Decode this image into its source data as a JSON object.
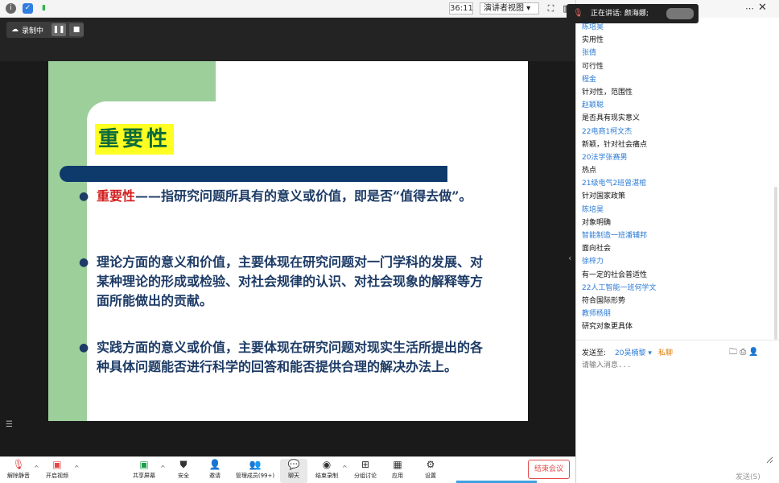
{
  "topbar": {
    "timer": "36:11",
    "view_mode": "演讲者视图 ▾"
  },
  "recording": {
    "label": "录制中"
  },
  "slide": {
    "title": "重要性",
    "bullets": [
      {
        "highlight": "重要性",
        "text": "——指研究问题所具有的意义或价值，即是否“值得去做”。"
      },
      {
        "highlight": "",
        "text": "理论方面的意义和价值，主要体现在研究问题对一门学科的发展、对某种理论的形成或检验、对社会规律的认识、对社会现象的解释等方面所能做出的贡献。"
      },
      {
        "highlight": "",
        "text": "实践方面的意义或价值，主要体现在研究问题对现实生活所提出的各种具体问题能否进行科学的回答和能否提供合理的解决办法上。"
      }
    ]
  },
  "toolbar": {
    "unmute": "解除静音",
    "start_video": "开启视频",
    "share_screen": "共享屏幕",
    "security": "安全",
    "invite": "邀请",
    "manage_members": "管理成员(99+)",
    "chat": "聊天",
    "end_recording": "结束录制",
    "breakout": "分组讨论",
    "apps": "应用",
    "settings": "设置",
    "end_meeting": "结束会议"
  },
  "chat": {
    "speaking": "正在讲话: 颜海娜;",
    "messages": [
      {
        "type": "name",
        "text": "陈培昊"
      },
      {
        "type": "text",
        "text": "实用性"
      },
      {
        "type": "name",
        "text": "张倩"
      },
      {
        "type": "text",
        "text": "可行性"
      },
      {
        "type": "name",
        "text": "程金"
      },
      {
        "type": "text",
        "text": "针对性，范围性"
      },
      {
        "type": "name",
        "text": "赵颖聪"
      },
      {
        "type": "text",
        "text": "是否具有现实意义"
      },
      {
        "type": "name",
        "text": "22电商1柯文杰"
      },
      {
        "type": "text",
        "text": "新颖，针对社会痛点"
      },
      {
        "type": "name",
        "text": "20法学张赛男"
      },
      {
        "type": "text",
        "text": "热点"
      },
      {
        "type": "name",
        "text": "21级电气2班曾湛棺"
      },
      {
        "type": "text",
        "text": "针对国家政策"
      },
      {
        "type": "name",
        "text": "陈培昊"
      },
      {
        "type": "text",
        "text": "对象明确"
      },
      {
        "type": "name",
        "text": "智能制造一班潘辅邦"
      },
      {
        "type": "text",
        "text": "面向社会"
      },
      {
        "type": "name",
        "text": "徐梓力"
      },
      {
        "type": "text",
        "text": "有一定的社会普适性"
      },
      {
        "type": "name",
        "text": "22人工智能一班何学文"
      },
      {
        "type": "text",
        "text": "符合国际形势"
      },
      {
        "type": "name",
        "text": "教师杨朋"
      },
      {
        "type": "text",
        "text": "研究对象更具体"
      }
    ],
    "send_to_label": "发送至:",
    "recipient": "20吴楠黎 ▾",
    "private": "私聊",
    "input_placeholder": "请输入消息...",
    "send_button": "发送(S)"
  },
  "colors": {
    "accent": "#2b7bd6",
    "end_red": "#e24a4a",
    "slide_green": "#9dcf9b",
    "slide_bar": "#0e3a6b"
  }
}
